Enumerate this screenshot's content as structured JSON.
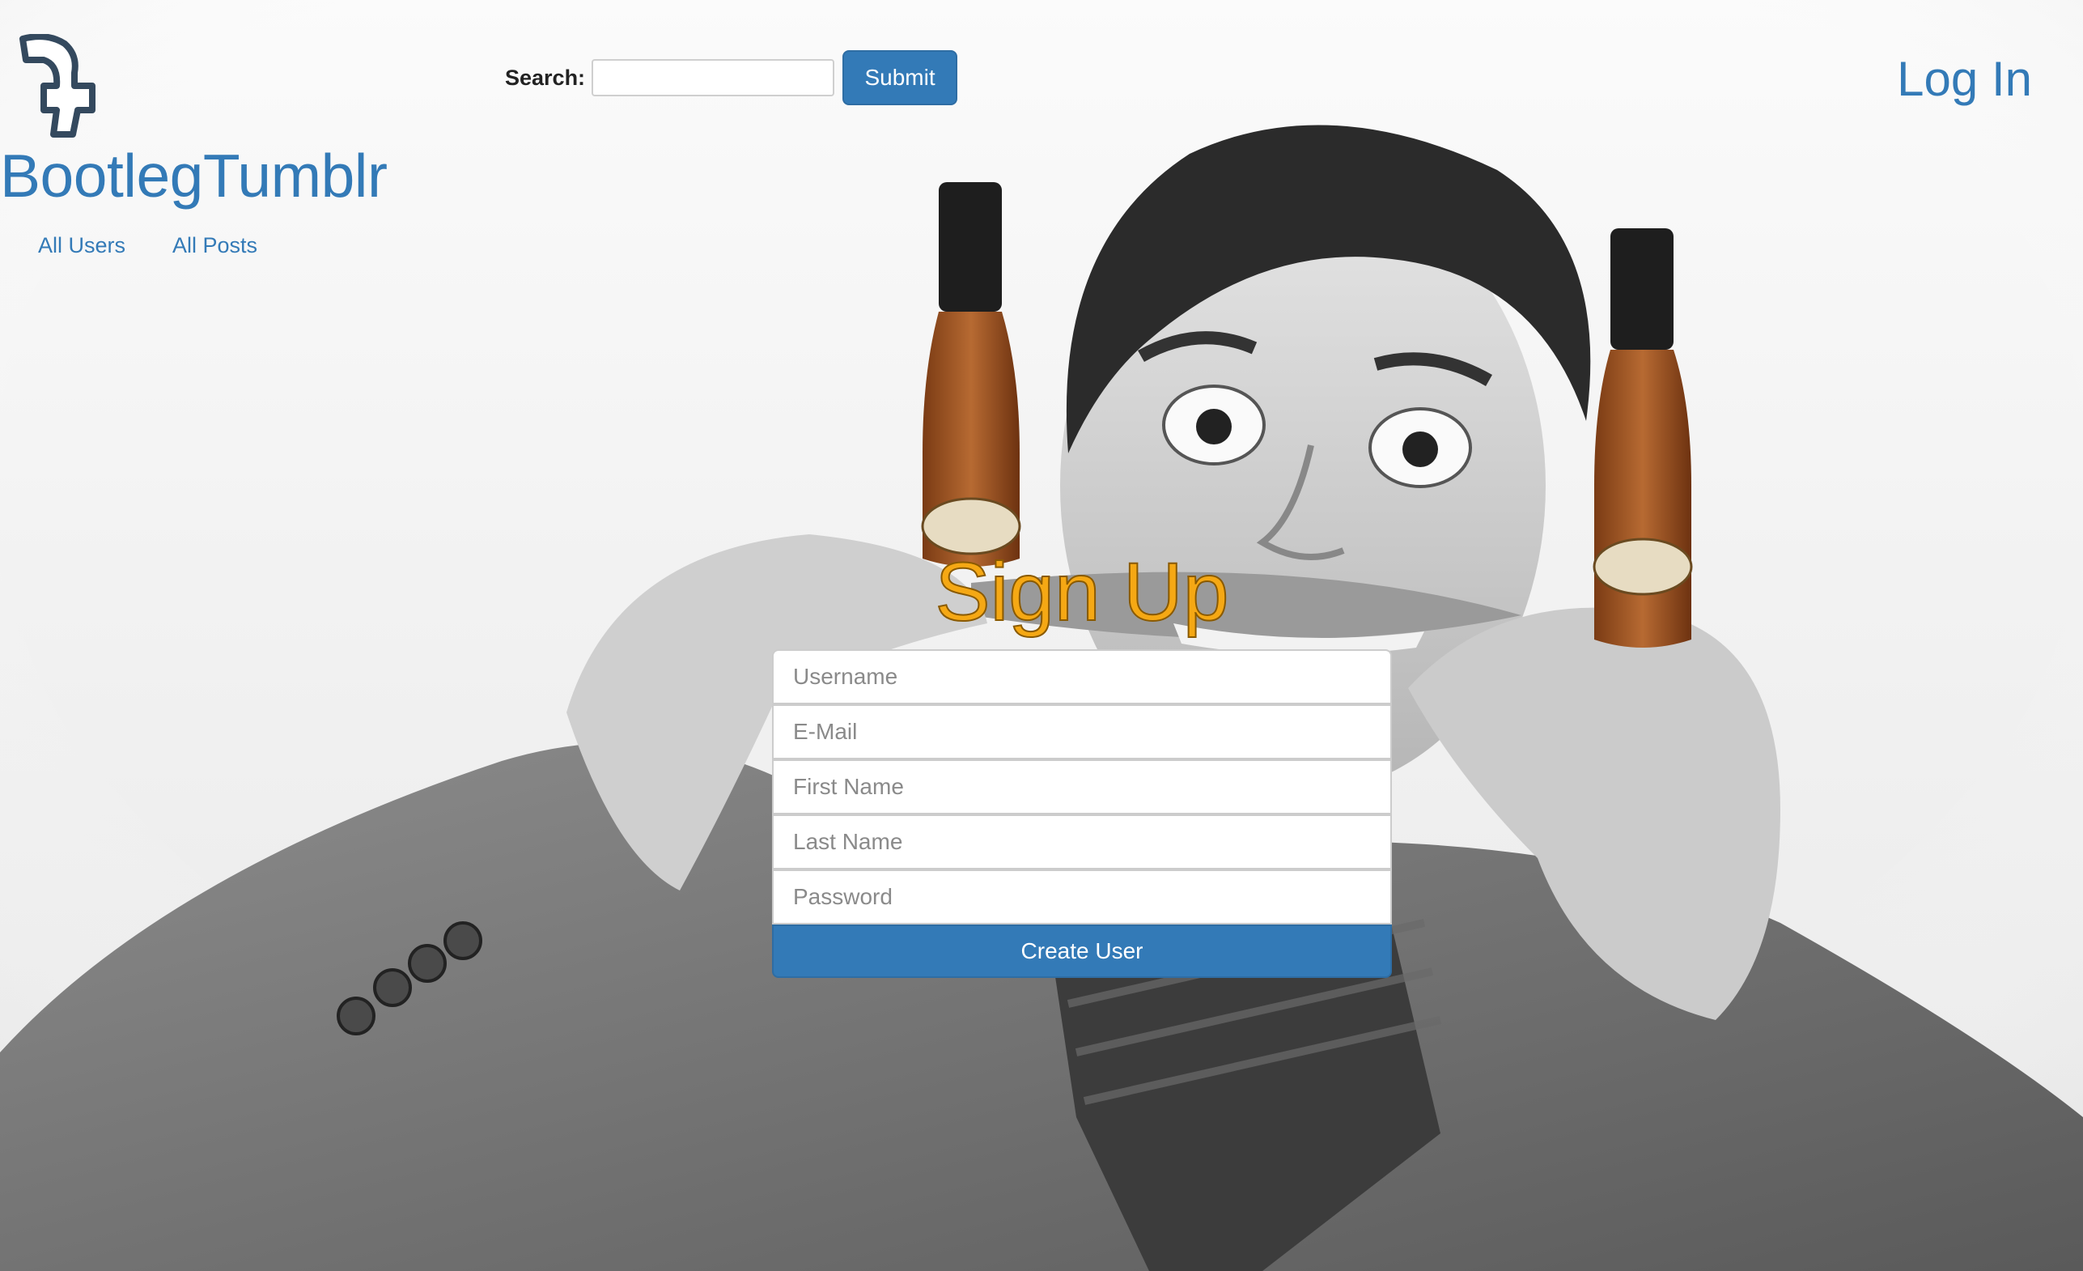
{
  "header": {
    "brand": "BootlegTumblr",
    "logo_icon": "tumblr-t-logo-icon",
    "nav": [
      {
        "label": "All Users"
      },
      {
        "label": "All Posts"
      }
    ],
    "search": {
      "label": "Search:",
      "value": "",
      "submit_label": "Submit"
    },
    "login_label": "Log In"
  },
  "signup": {
    "title": "Sign Up",
    "fields": [
      {
        "placeholder": "Username"
      },
      {
        "placeholder": "E-Mail"
      },
      {
        "placeholder": "First Name"
      },
      {
        "placeholder": "Last Name"
      },
      {
        "placeholder": "Password"
      }
    ],
    "submit_label": "Create User"
  },
  "colors": {
    "link": "#337ab7",
    "title": "#f5a814",
    "button": "#337ab7"
  }
}
